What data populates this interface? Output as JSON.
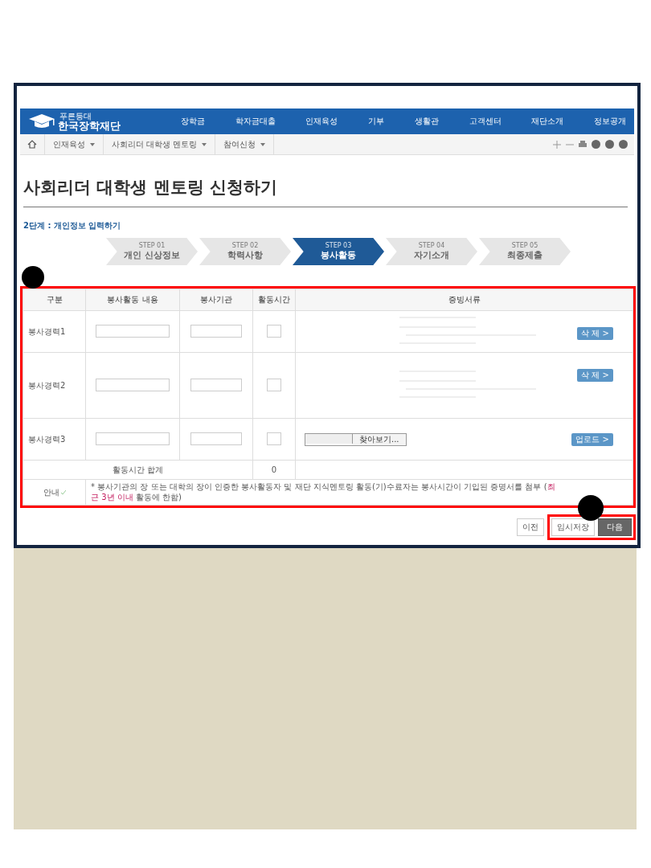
{
  "header": {
    "logo_tagline": "푸른등대",
    "logo": "한국장학재단",
    "nav": [
      "장학금",
      "학자금대출",
      "인재육성",
      "기부",
      "생활관",
      "고객센터",
      "재단소개",
      "정보공개"
    ]
  },
  "breadcrumb": [
    "인재육성",
    "사회리더 대학생 멘토링",
    "참여신청"
  ],
  "page_title": "사회리더 대학생 멘토링 신청하기",
  "step_heading": "2단계 : 개인정보 입력하기",
  "steps": [
    {
      "number": "STEP 01",
      "label": "개인 신상정보",
      "selected": false
    },
    {
      "number": "STEP 02",
      "label": "학력사항",
      "selected": false
    },
    {
      "number": "STEP 03",
      "label": "봉사활동",
      "selected": true
    },
    {
      "number": "STEP 04",
      "label": "자기소개",
      "selected": false
    },
    {
      "number": "STEP 05",
      "label": "최종제출",
      "selected": false
    }
  ],
  "table": {
    "columns": [
      "구분",
      "봉사활동 내용",
      "봉사기관",
      "활동시간",
      "증빙서류"
    ],
    "rows": [
      {
        "label": "봉사경력1",
        "kind": "uploaded",
        "action": "삭 제 >"
      },
      {
        "label": "봉사경력2",
        "kind": "uploaded",
        "action": "삭 제 >"
      },
      {
        "label": "봉사경력3",
        "kind": "upload",
        "browse": "찾아보기...",
        "action": "업로드 >"
      }
    ],
    "total": {
      "label": "활동시간 합계",
      "value": "0"
    },
    "notice": {
      "label": "안내",
      "text": "* 봉사기관의 장 또는 대학의 장이 인증한 봉사활동자 및 재단 지식멘토링 활동(기)수료자는 봉사시간이 기입된 증명서를 첨부 (**최근 3년 이내** 활동에 한함)"
    }
  },
  "buttons": [
    {
      "label": "이전",
      "kind": "plain"
    },
    {
      "label": "임시저장",
      "kind": "plain"
    },
    {
      "label": "다음",
      "kind": "primary"
    }
  ]
}
